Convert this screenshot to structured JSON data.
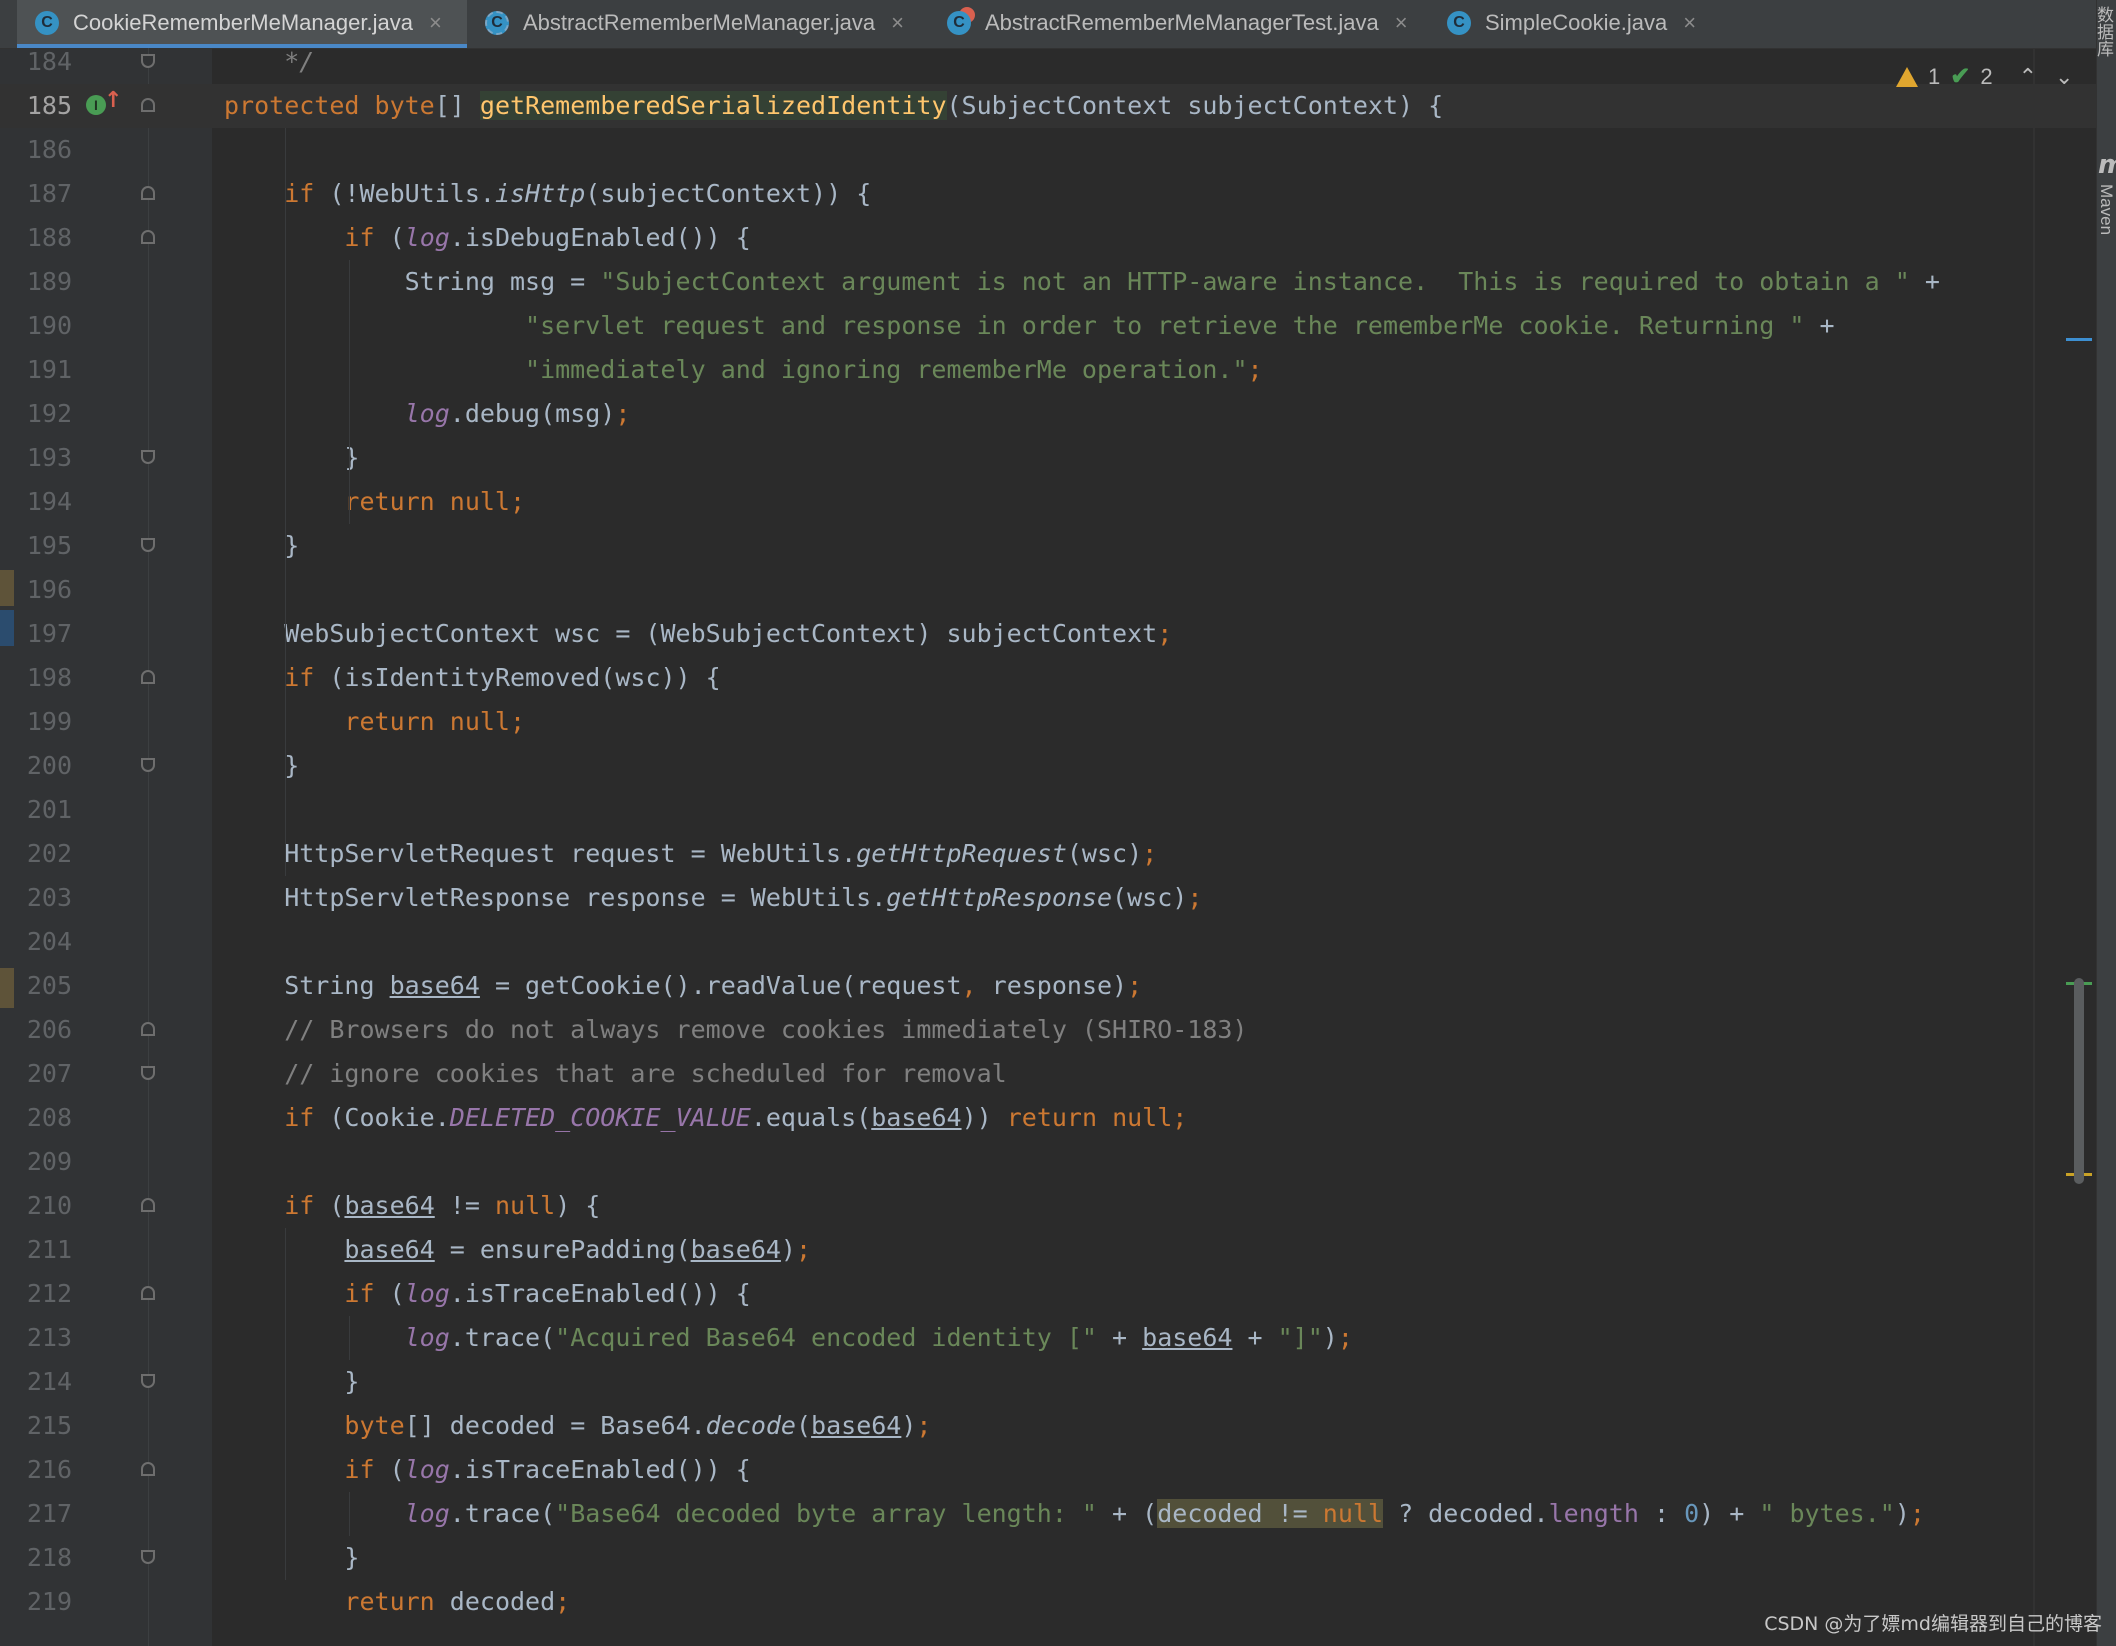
{
  "tabs": [
    {
      "label": "CookieRememberMeManager.java",
      "icon": "class-icon",
      "active": true
    },
    {
      "label": "AbstractRememberMeManager.java",
      "icon": "abstract-class-icon",
      "active": false
    },
    {
      "label": "AbstractRememberMeManagerTest.java",
      "icon": "test-class-icon",
      "active": false
    },
    {
      "label": "SimpleCookie.java",
      "icon": "class-icon",
      "active": false
    }
  ],
  "inspections": {
    "warnings": "1",
    "weak_warnings": "2"
  },
  "side_panels": {
    "database": "数据库",
    "maven": "Maven"
  },
  "editor": {
    "current_line": "185",
    "lines": [
      {
        "n": "184"
      },
      {
        "n": "185"
      },
      {
        "n": "186"
      },
      {
        "n": "187"
      },
      {
        "n": "188"
      },
      {
        "n": "189"
      },
      {
        "n": "190"
      },
      {
        "n": "191"
      },
      {
        "n": "192"
      },
      {
        "n": "193"
      },
      {
        "n": "194"
      },
      {
        "n": "195"
      },
      {
        "n": "196"
      },
      {
        "n": "197"
      },
      {
        "n": "198"
      },
      {
        "n": "199"
      },
      {
        "n": "200"
      },
      {
        "n": "201"
      },
      {
        "n": "202"
      },
      {
        "n": "203"
      },
      {
        "n": "204"
      },
      {
        "n": "205"
      },
      {
        "n": "206"
      },
      {
        "n": "207"
      },
      {
        "n": "208"
      },
      {
        "n": "209"
      },
      {
        "n": "210"
      },
      {
        "n": "211"
      },
      {
        "n": "212"
      },
      {
        "n": "213"
      },
      {
        "n": "214"
      },
      {
        "n": "215"
      },
      {
        "n": "216"
      },
      {
        "n": "217"
      },
      {
        "n": "218"
      },
      {
        "n": "219"
      }
    ],
    "code": [
      [
        {
          "t": "    "
        },
        {
          "t": "*/",
          "c": "it c"
        }
      ],
      [
        {
          "t": "protected",
          "c": "k"
        },
        {
          "t": " "
        },
        {
          "t": "byte",
          "c": "k"
        },
        {
          "t": "[] "
        },
        {
          "t": "getRememberedSerializedIdentity",
          "c": "mh"
        },
        {
          "t": "(SubjectContext subjectContext) {"
        }
      ],
      [],
      [
        {
          "t": "    "
        },
        {
          "t": "if",
          "c": "k"
        },
        {
          "t": " (!WebUtils."
        },
        {
          "t": "isHttp",
          "c": "it"
        },
        {
          "t": "(subjectContext)) {"
        }
      ],
      [
        {
          "t": "        "
        },
        {
          "t": "if",
          "c": "k"
        },
        {
          "t": " ("
        },
        {
          "t": "log",
          "c": "st"
        },
        {
          "t": ".isDebugEnabled()) {"
        }
      ],
      [
        {
          "t": "            String msg = "
        },
        {
          "t": "\"SubjectContext argument is not an HTTP-aware instance.  This is required to obtain a \"",
          "c": "s"
        },
        {
          "t": " +"
        }
      ],
      [
        {
          "t": "                    "
        },
        {
          "t": "\"servlet request and response in order to retrieve the rememberMe cookie. Returning \"",
          "c": "s"
        },
        {
          "t": " +"
        }
      ],
      [
        {
          "t": "                    "
        },
        {
          "t": "\"immediately and ignoring rememberMe operation.\"",
          "c": "s"
        },
        {
          "t": ";",
          "c": "k"
        }
      ],
      [
        {
          "t": "            "
        },
        {
          "t": "log",
          "c": "st"
        },
        {
          "t": ".debug(msg)"
        },
        {
          "t": ";",
          "c": "k"
        }
      ],
      [
        {
          "t": "        }"
        }
      ],
      [
        {
          "t": "        "
        },
        {
          "t": "return null;",
          "c": "k"
        }
      ],
      [
        {
          "t": "    }"
        }
      ],
      [],
      [
        {
          "t": "    WebSubjectContext wsc = (WebSubjectContext) subjectContext"
        },
        {
          "t": ";",
          "c": "k"
        }
      ],
      [
        {
          "t": "    "
        },
        {
          "t": "if",
          "c": "k"
        },
        {
          "t": " (isIdentityRemoved(wsc)) {"
        }
      ],
      [
        {
          "t": "        "
        },
        {
          "t": "return null;",
          "c": "k"
        }
      ],
      [
        {
          "t": "    }"
        }
      ],
      [],
      [
        {
          "t": "    HttpServletRequest request = WebUtils."
        },
        {
          "t": "getHttpRequest",
          "c": "it"
        },
        {
          "t": "(wsc)"
        },
        {
          "t": ";",
          "c": "k"
        }
      ],
      [
        {
          "t": "    HttpServletResponse response = WebUtils."
        },
        {
          "t": "getHttpResponse",
          "c": "it"
        },
        {
          "t": "(wsc)"
        },
        {
          "t": ";",
          "c": "k"
        }
      ],
      [],
      [
        {
          "t": "    String "
        },
        {
          "t": "base64",
          "c": "u"
        },
        {
          "t": " = getCookie().readValue(request"
        },
        {
          "t": ",",
          "c": "k"
        },
        {
          "t": " response)"
        },
        {
          "t": ";",
          "c": "k"
        }
      ],
      [
        {
          "t": "    // Browsers do not always remove cookies immediately (SHIRO-183)",
          "c": "c"
        }
      ],
      [
        {
          "t": "    // ignore cookies that are scheduled for removal",
          "c": "c"
        }
      ],
      [
        {
          "t": "    "
        },
        {
          "t": "if",
          "c": "k"
        },
        {
          "t": " (Cookie."
        },
        {
          "t": "DELETED_COOKIE_VALUE",
          "c": "st"
        },
        {
          "t": ".equals("
        },
        {
          "t": "base64",
          "c": "u"
        },
        {
          "t": ")) "
        },
        {
          "t": "return null;",
          "c": "k"
        }
      ],
      [],
      [
        {
          "t": "    "
        },
        {
          "t": "if",
          "c": "k"
        },
        {
          "t": " ("
        },
        {
          "t": "base64",
          "c": "u"
        },
        {
          "t": " != "
        },
        {
          "t": "null",
          "c": "k"
        },
        {
          "t": ") {"
        }
      ],
      [
        {
          "t": "        "
        },
        {
          "t": "base64",
          "c": "u"
        },
        {
          "t": " = ensurePadding("
        },
        {
          "t": "base64",
          "c": "u"
        },
        {
          "t": ")"
        },
        {
          "t": ";",
          "c": "k"
        }
      ],
      [
        {
          "t": "        "
        },
        {
          "t": "if",
          "c": "k"
        },
        {
          "t": " ("
        },
        {
          "t": "log",
          "c": "st"
        },
        {
          "t": ".isTraceEnabled()) {"
        }
      ],
      [
        {
          "t": "            "
        },
        {
          "t": "log",
          "c": "st"
        },
        {
          "t": ".trace("
        },
        {
          "t": "\"Acquired Base64 encoded identity [\"",
          "c": "s"
        },
        {
          "t": " + "
        },
        {
          "t": "base64",
          "c": "u"
        },
        {
          "t": " + "
        },
        {
          "t": "\"]\"",
          "c": "s"
        },
        {
          "t": ")"
        },
        {
          "t": ";",
          "c": "k"
        }
      ],
      [
        {
          "t": "        }"
        }
      ],
      [
        {
          "t": "        "
        },
        {
          "t": "byte",
          "c": "k"
        },
        {
          "t": "[] decoded = Base64."
        },
        {
          "t": "decode",
          "c": "it"
        },
        {
          "t": "("
        },
        {
          "t": "base64",
          "c": "u"
        },
        {
          "t": ")"
        },
        {
          "t": ";",
          "c": "k"
        }
      ],
      [
        {
          "t": "        "
        },
        {
          "t": "if",
          "c": "k"
        },
        {
          "t": " ("
        },
        {
          "t": "log",
          "c": "st"
        },
        {
          "t": ".isTraceEnabled()) {"
        }
      ],
      [
        {
          "t": "            "
        },
        {
          "t": "log",
          "c": "st"
        },
        {
          "t": ".trace("
        },
        {
          "t": "\"Base64 decoded byte array length: \"",
          "c": "s"
        },
        {
          "t": " + ("
        },
        {
          "t": "decoded != ",
          "c": "hl"
        },
        {
          "t": "null",
          "c": "k hl"
        },
        {
          "t": " ? decoded."
        },
        {
          "t": "length",
          "c": "pr"
        },
        {
          "t": " : "
        },
        {
          "t": "0",
          "c": "n"
        },
        {
          "t": ") + "
        },
        {
          "t": "\" bytes.\"",
          "c": "s"
        },
        {
          "t": ")"
        },
        {
          "t": ";",
          "c": "k"
        }
      ],
      [
        {
          "t": "        }"
        }
      ],
      [
        {
          "t": "        "
        },
        {
          "t": "return",
          "c": "k"
        },
        {
          "t": " decoded"
        },
        {
          "t": ";",
          "c": "k"
        }
      ]
    ]
  },
  "watermark": "CSDN @为了嫖md编辑器到自己的博客"
}
